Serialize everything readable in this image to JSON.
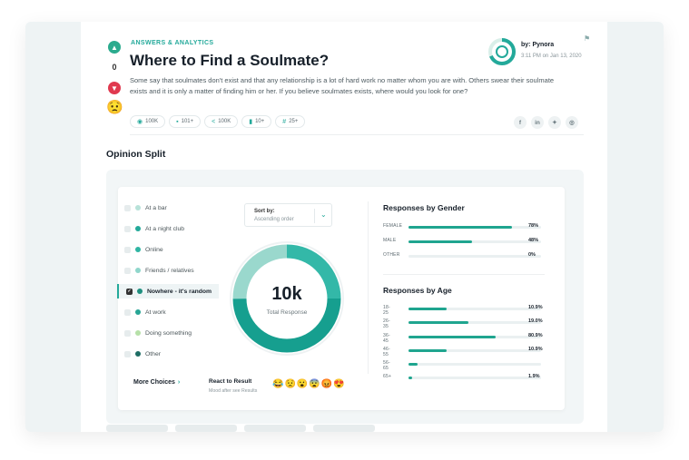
{
  "header": {
    "category": "ANSWERS & ANALYTICS",
    "title": "Where to Find a Soulmate?",
    "description": "Some say that soulmates don't exist and that any relationship is a lot of hard work no matter whom you are with. Others swear their soulmate exists and it is only a matter of finding him or her. If you believe soulmates exists, where would you look for one?",
    "author": "by: Pynora",
    "date": "3:11 PM on Jan 13, 2020"
  },
  "votes": {
    "count": "0",
    "up_icon": "thumbs-up-icon",
    "down_icon": "thumbs-down-icon",
    "emoji": "😟"
  },
  "stats": [
    {
      "icon": "eye-icon",
      "label": "100K"
    },
    {
      "icon": "comment-icon",
      "label": "101+"
    },
    {
      "icon": "share-icon",
      "label": "100K"
    },
    {
      "icon": "document-icon",
      "label": "10+"
    },
    {
      "icon": "hashtag-icon",
      "label": "25+"
    }
  ],
  "socials": [
    "f",
    "in",
    "tw",
    "ig"
  ],
  "opinion": {
    "section_title": "Opinion Split",
    "options": [
      {
        "label": "At a bar",
        "color": "#b7e2d9"
      },
      {
        "label": "At a night club",
        "color": "#23a99a"
      },
      {
        "label": "Online",
        "color": "#2fb5a3"
      },
      {
        "label": "Friends / relatives",
        "color": "#8fd6cb"
      },
      {
        "label": "Nowhere - it's random",
        "color": "#1f8f7f"
      },
      {
        "label": "At work",
        "color": "#27a595"
      },
      {
        "label": "Doing something",
        "color": "#b6e0a8"
      },
      {
        "label": "Other",
        "color": "#1e6d64"
      }
    ],
    "selected_option": "Nowhere - it's random",
    "sort_label": "Sort by:",
    "sort_value": "Ascending order",
    "total_value": "10k",
    "total_label": "Total Response",
    "more_choices": "More Choices",
    "react_title": "React to Result",
    "react_sub": "Mood after see Results",
    "reactions": [
      "😂",
      "😟",
      "😮",
      "😨",
      "😡",
      "😍"
    ]
  },
  "gender": {
    "title": "Responses by Gender",
    "rows": [
      {
        "label": "FEMALE",
        "value": "78%",
        "pct": 78
      },
      {
        "label": "MALE",
        "value": "48%",
        "pct": 48
      },
      {
        "label": "OTHER",
        "value": "0%",
        "pct": 0
      }
    ]
  },
  "age": {
    "title": "Responses by Age",
    "rows": [
      {
        "label": "18-25",
        "value": "10.9%",
        "pct": 29
      },
      {
        "label": "26-35",
        "value": "19.0%",
        "pct": 45
      },
      {
        "label": "36-45",
        "value": "80.9%",
        "pct": 66
      },
      {
        "label": "46-55",
        "value": "10.9%",
        "pct": 29
      },
      {
        "label": "56-65",
        "value": "",
        "pct": 7
      },
      {
        "label": "65+",
        "value": "1.9%",
        "pct": 3
      }
    ]
  }
}
